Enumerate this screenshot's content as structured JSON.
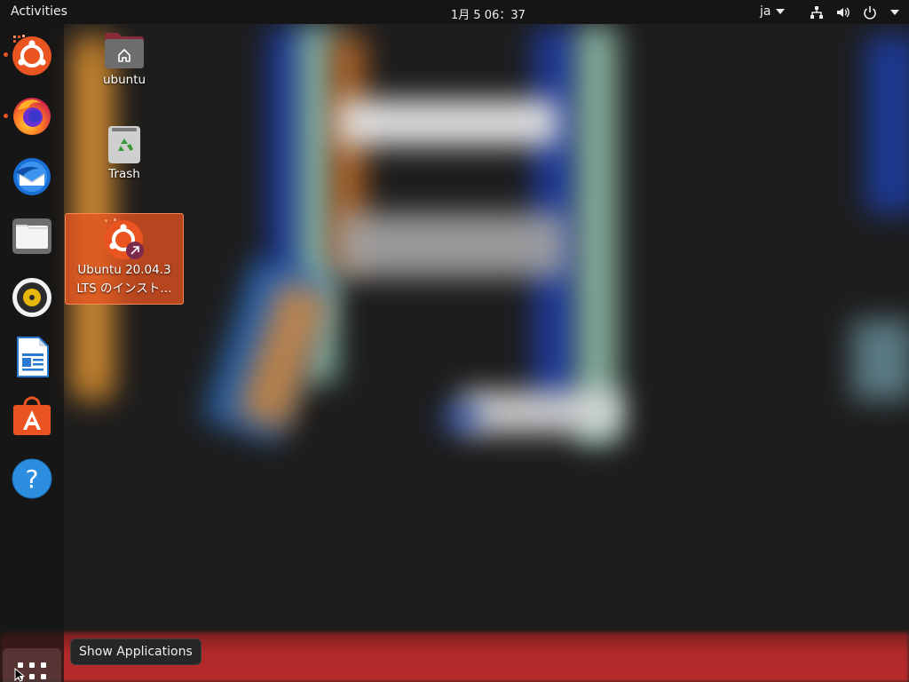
{
  "topbar": {
    "activities_label": "Activities",
    "clock": "1月 5  06：37",
    "language": "ja",
    "network_icon": "network-wired-icon",
    "volume_icon": "volume-icon",
    "power_icon": "power-icon",
    "menu_arrow_icon": "chevron-down-icon"
  },
  "dock": {
    "items": [
      {
        "name": "ubuntu-installer",
        "icon": "ubuntu-installer-icon",
        "running": true
      },
      {
        "name": "firefox",
        "icon": "firefox-icon",
        "running": true
      },
      {
        "name": "thunderbird",
        "icon": "thunderbird-icon",
        "running": false
      },
      {
        "name": "files",
        "icon": "files-icon",
        "running": false
      },
      {
        "name": "rhythmbox",
        "icon": "rhythmbox-icon",
        "running": false
      },
      {
        "name": "libreoffice-writer",
        "icon": "writer-icon",
        "running": false
      },
      {
        "name": "ubuntu-software",
        "icon": "software-icon",
        "running": false
      },
      {
        "name": "help",
        "icon": "help-icon",
        "running": false
      }
    ],
    "show_applications_icon": "app-grid-icon"
  },
  "tooltip": {
    "text": "Show Applications"
  },
  "desktop": {
    "home": {
      "label": "ubuntu",
      "icon": "home-folder-icon"
    },
    "trash": {
      "label": "Trash",
      "icon": "trash-icon"
    },
    "installer": {
      "label_line1": "Ubuntu 20.04.3",
      "label_line2": "LTS のインスト…",
      "icon": "ubuntu-installer-shortcut-icon"
    }
  },
  "colors": {
    "accent": "#e95420",
    "panel": "#151515",
    "tooltip_bg": "#262626"
  }
}
